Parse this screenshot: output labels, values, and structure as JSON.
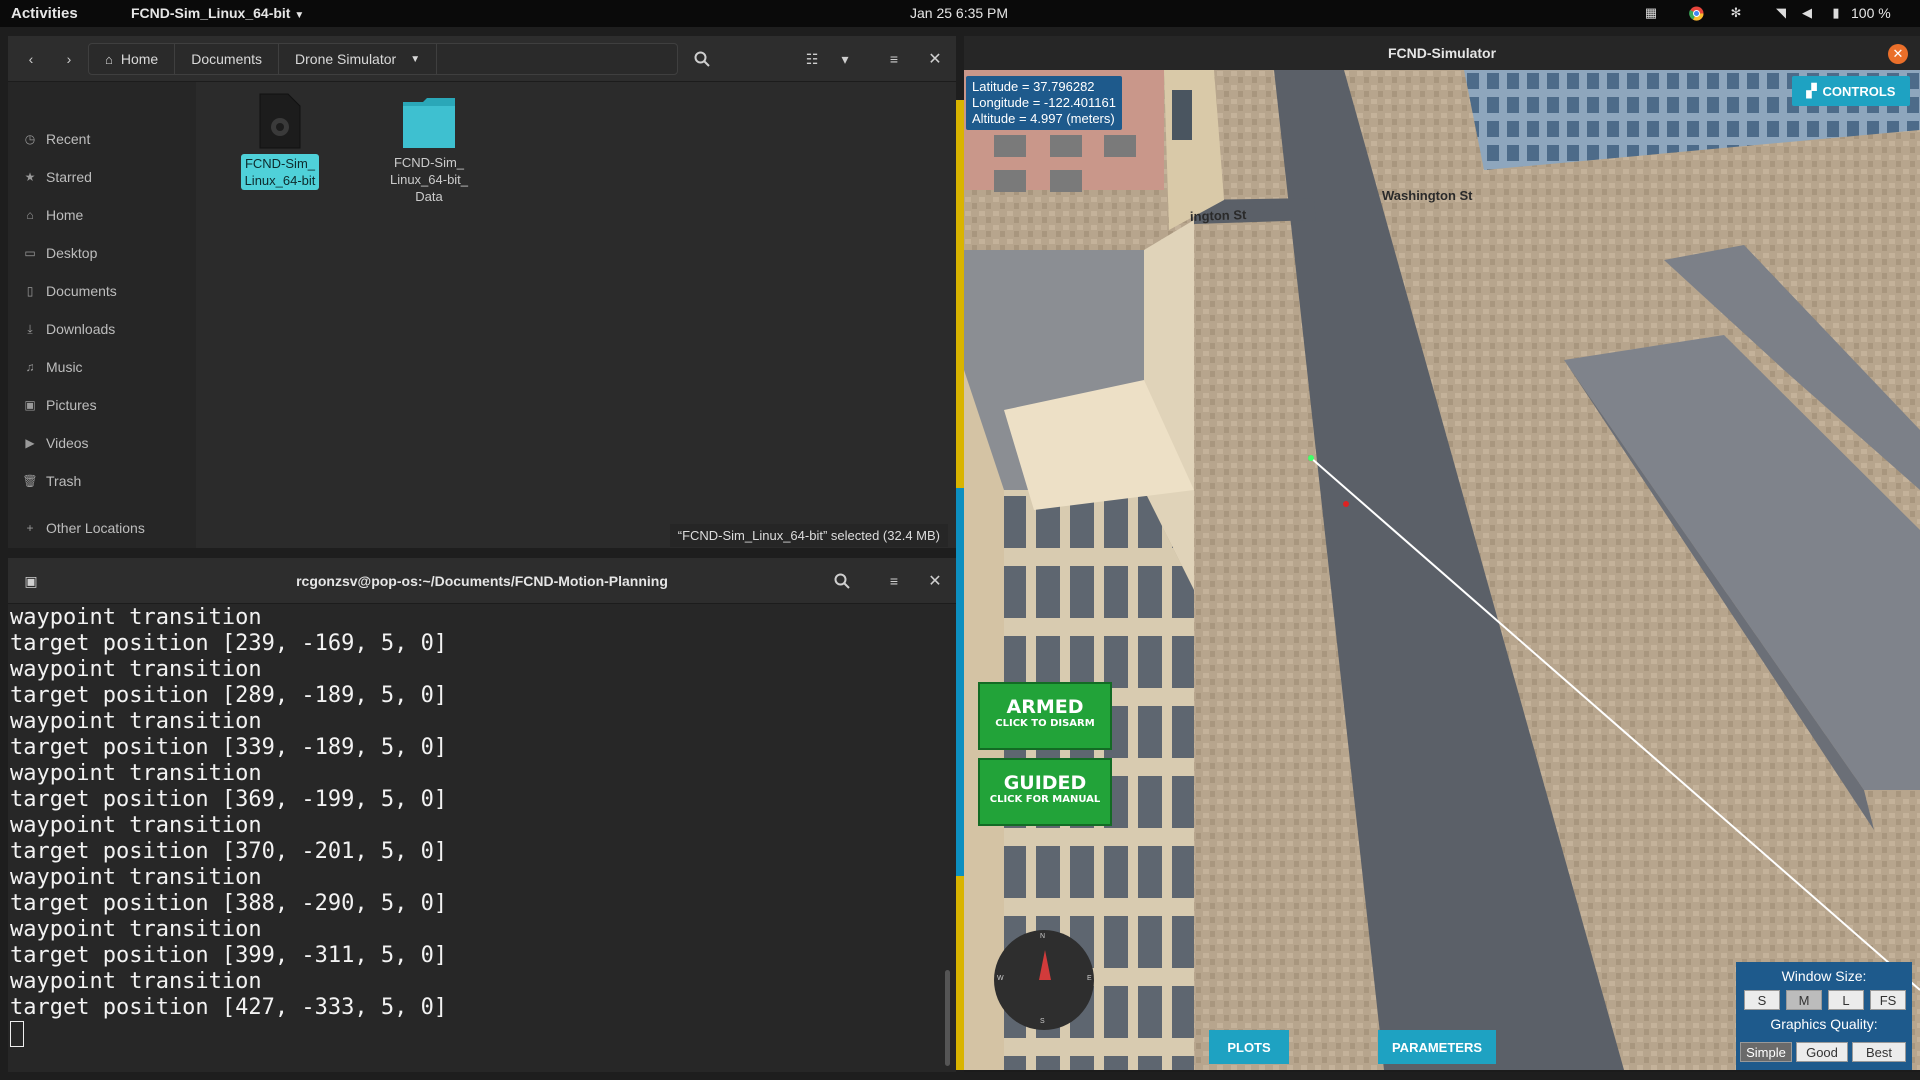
{
  "topbar": {
    "activities": "Activities",
    "app_menu": "FCND-Sim_Linux_64-bit",
    "datetime": "Jan 25   6:35 PM",
    "battery": "100 %"
  },
  "file_manager": {
    "breadcrumbs": [
      "Home",
      "Documents",
      "Drone Simulator"
    ],
    "sidebar": [
      {
        "label": "Recent",
        "icon": "clock-icon"
      },
      {
        "label": "Starred",
        "icon": "star-icon"
      },
      {
        "label": "Home",
        "icon": "home-icon"
      },
      {
        "label": "Desktop",
        "icon": "desktop-icon"
      },
      {
        "label": "Documents",
        "icon": "document-icon"
      },
      {
        "label": "Downloads",
        "icon": "download-icon"
      },
      {
        "label": "Music",
        "icon": "music-icon"
      },
      {
        "label": "Pictures",
        "icon": "picture-icon"
      },
      {
        "label": "Videos",
        "icon": "video-icon"
      },
      {
        "label": "Trash",
        "icon": "trash-icon"
      },
      {
        "label": "Other Locations",
        "icon": "plus-icon"
      }
    ],
    "items": [
      {
        "line1": "FCND-Sim_",
        "line2": "Linux_64-bit",
        "type": "executable"
      },
      {
        "line1": "FCND-Sim_",
        "line2": "Linux_64-bit_",
        "line3": "Data",
        "type": "folder"
      }
    ],
    "status": "“FCND-Sim_Linux_64-bit” selected  (32.4 MB)"
  },
  "terminal": {
    "title": "rcgonzsv@pop-os:~/Documents/FCND-Motion-Planning",
    "lines": [
      "waypoint transition",
      "target position [239, -169, 5, 0]",
      "waypoint transition",
      "target position [289, -189, 5, 0]",
      "waypoint transition",
      "target position [339, -189, 5, 0]",
      "waypoint transition",
      "target position [369, -199, 5, 0]",
      "waypoint transition",
      "target position [370, -201, 5, 0]",
      "waypoint transition",
      "target position [388, -290, 5, 0]",
      "waypoint transition",
      "target position [399, -311, 5, 0]",
      "waypoint transition",
      "target position [427, -333, 5, 0]"
    ]
  },
  "simulator": {
    "title": "FCND-Simulator",
    "latitude": "Latitude = 37.796282",
    "longitude": "Longitude = -122.401161",
    "altitude": "Altitude = 4.997 (meters)",
    "controls": "CONTROLS",
    "street1": "Washington St",
    "street2": "ington St",
    "armed": "ARMED",
    "armed_sub": "CLICK TO DISARM",
    "guided": "GUIDED",
    "guided_sub": "CLICK FOR MANUAL",
    "compass_n": "N",
    "compass_s": "S",
    "compass_e": "E",
    "compass_w": "W",
    "plots": "PLOTS",
    "parameters": "PARAMETERS",
    "window_size_label": "Window Size:",
    "sizes": [
      "S",
      "M",
      "L",
      "FS"
    ],
    "quality_label": "Graphics Quality:",
    "qualities": [
      "Simple",
      "Good",
      "Best"
    ]
  }
}
